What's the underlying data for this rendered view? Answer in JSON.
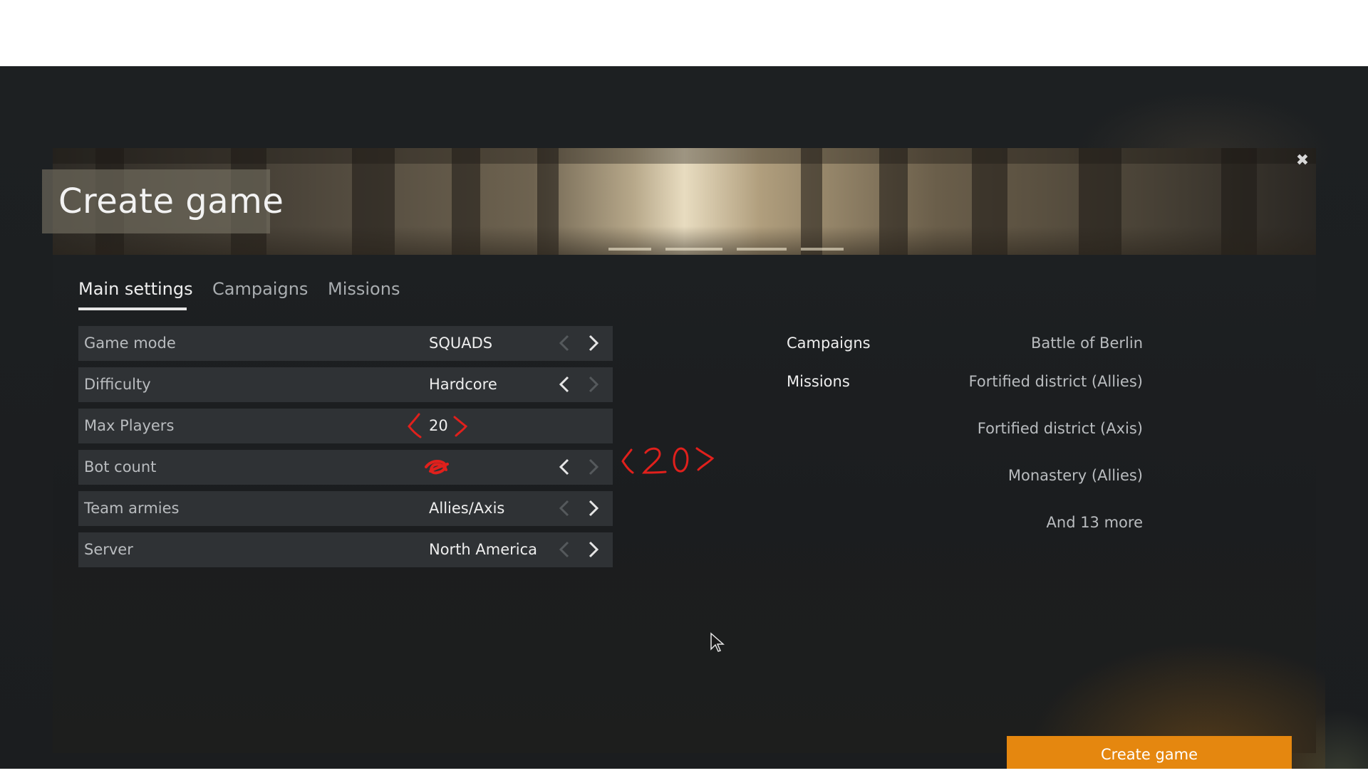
{
  "dialog": {
    "title": "Create game",
    "close_icon": "close-icon"
  },
  "tabs": [
    {
      "label": "Main settings",
      "active": true
    },
    {
      "label": "Campaigns",
      "active": false
    },
    {
      "label": "Missions",
      "active": false
    }
  ],
  "settings": [
    {
      "label": "Game mode",
      "value": "SQUADS",
      "prev_enabled": false,
      "next_enabled": true
    },
    {
      "label": "Difficulty",
      "value": "Hardcore",
      "prev_enabled": true,
      "next_enabled": false
    },
    {
      "label": "Max Players",
      "value": "20"
    },
    {
      "label": "Bot count",
      "value": "",
      "prev_enabled": true,
      "next_enabled": false
    },
    {
      "label": "Team armies",
      "value": "Allies/Axis",
      "prev_enabled": false,
      "next_enabled": true
    },
    {
      "label": "Server",
      "value": "North America",
      "prev_enabled": false,
      "next_enabled": true
    }
  ],
  "summary": {
    "campaigns_label": "Campaigns",
    "campaigns_value": "Battle of Berlin",
    "missions_label": "Missions",
    "missions_values": [
      "Fortified district (Allies)",
      "Fortified district (Axis)",
      "Monastery (Allies)",
      "And 13 more"
    ]
  },
  "annotation": {
    "sketch_text": "<20>"
  },
  "create_button": {
    "label": "Create game"
  },
  "colors": {
    "accent": "#e5870f",
    "row_bg": "#2f3235",
    "dialog_bg": "#1e2123",
    "annotation_red": "#e0201c"
  }
}
